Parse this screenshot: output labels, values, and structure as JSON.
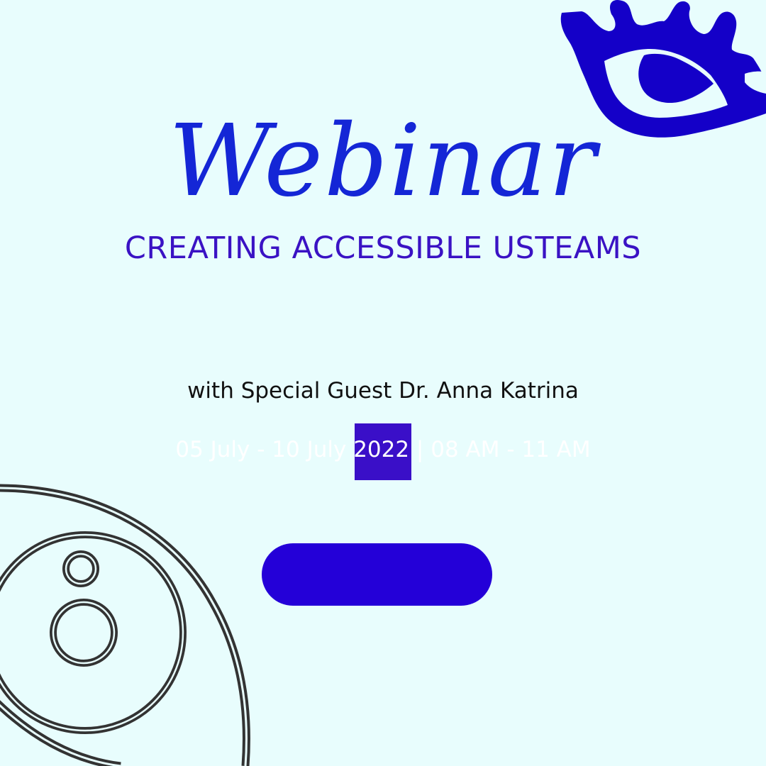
{
  "colors": {
    "background": "#e8fdfd",
    "title_blue": "#1426d6",
    "subtitle_purple": "#3a12c4",
    "guest_text": "#111111",
    "date_text": "#ffffff",
    "highlight": "#3a0fc8",
    "button": "#2400d8",
    "eye_top_fill": "#1400c8",
    "eye_bottom_stroke": "#333333"
  },
  "icons": {
    "top_decoration": "eye-icon",
    "bottom_decoration": "eye-outline-icon"
  },
  "content": {
    "title": "Webinar",
    "subtitle": "CREATING ACCESSIBLE USTEAMS",
    "guest": "with Special Guest Dr. Anna Katrina",
    "date": "05 July - 10 July 2022 | 08 AM - 11 AM",
    "button_label": ""
  }
}
